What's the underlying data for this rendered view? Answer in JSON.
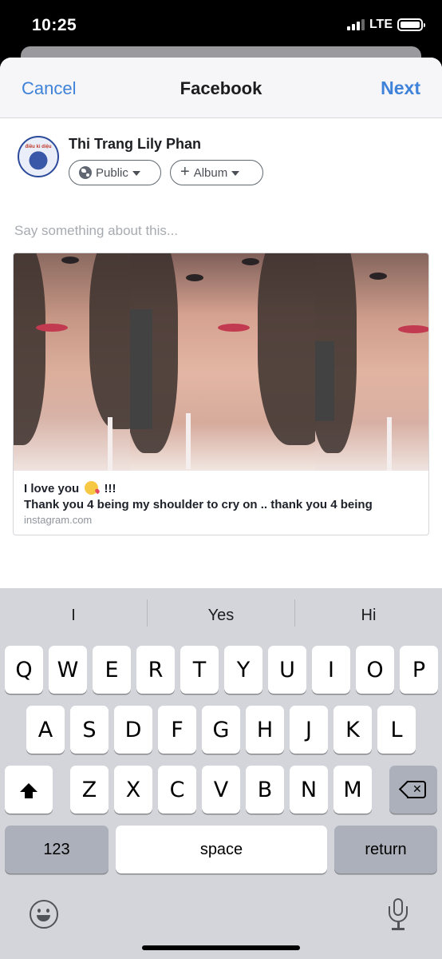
{
  "status_bar": {
    "time": "10:25",
    "network": "LTE"
  },
  "nav": {
    "cancel": "Cancel",
    "title": "Facebook",
    "next": "Next"
  },
  "post": {
    "author_name": "Thi Trang Lily Phan",
    "avatar_text": "điều kì diệu",
    "audience": "Public",
    "album": "Album",
    "composer_placeholder": "Say something about this...",
    "link": {
      "title_start": "I love you",
      "title_end": "!!!",
      "description": "Thank you 4 being my shoulder to cry on .. thank you 4 being",
      "domain": "instagram.com"
    }
  },
  "keyboard": {
    "suggestions": [
      "I",
      "Yes",
      "Hi"
    ],
    "row1": [
      "Q",
      "W",
      "E",
      "R",
      "T",
      "Y",
      "U",
      "I",
      "O",
      "P"
    ],
    "row2": [
      "A",
      "S",
      "D",
      "F",
      "G",
      "H",
      "J",
      "K",
      "L"
    ],
    "row3": [
      "Z",
      "X",
      "C",
      "V",
      "B",
      "N",
      "M"
    ],
    "numbers": "123",
    "space": "space",
    "return": "return"
  },
  "colors": {
    "accent": "#3f82d9",
    "keyboard_bg": "#d3d5db",
    "special_key": "#abb0ba"
  },
  "icons": [
    "globe-icon",
    "plus-icon",
    "shift-icon",
    "backspace-icon",
    "emoji-icon",
    "microphone-icon"
  ]
}
